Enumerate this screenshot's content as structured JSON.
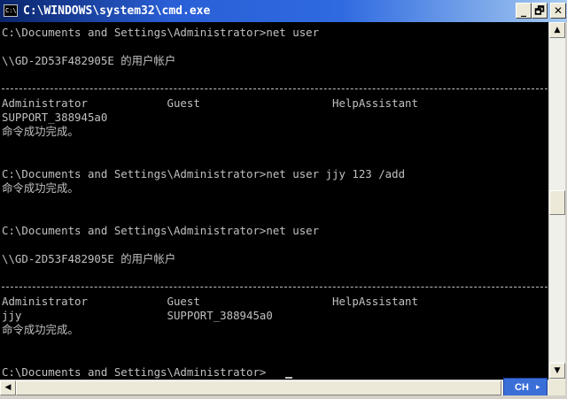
{
  "window": {
    "title": "C:\\WINDOWS\\system32\\cmd.exe",
    "icon_text": "C:\\",
    "minimize_glyph": "_",
    "maximize_glyph": "🗗",
    "close_glyph": "✕"
  },
  "console": {
    "lines": [
      "C:\\Documents and Settings\\Administrator>net user",
      "",
      "\\\\GD-2D53F482905E 的用户帐户",
      "",
      "-------------------------------------------------------------------------------",
      "Administrator            Guest                    HelpAssistant",
      "SUPPORT_388945a0",
      "命令成功完成。",
      "",
      "",
      "C:\\Documents and Settings\\Administrator>net user jjy 123 /add",
      "命令成功完成。",
      "",
      "",
      "C:\\Documents and Settings\\Administrator>net user",
      "",
      "\\\\GD-2D53F482905E 的用户帐户",
      "",
      "-------------------------------------------------------------------------------",
      "Administrator            Guest                    HelpAssistant",
      "jjy                      SUPPORT_388945a0",
      "命令成功完成。",
      "",
      "",
      "C:\\Documents and Settings\\Administrator>"
    ]
  },
  "ime": {
    "label": "CH",
    "arrow": "▸"
  },
  "scrollbar": {
    "up": "▲",
    "down": "▼",
    "left": "◀",
    "right": "▶"
  },
  "colors": {
    "text": "#c0c0c0",
    "background": "#000000",
    "titlebar": "#2a5fd6"
  }
}
